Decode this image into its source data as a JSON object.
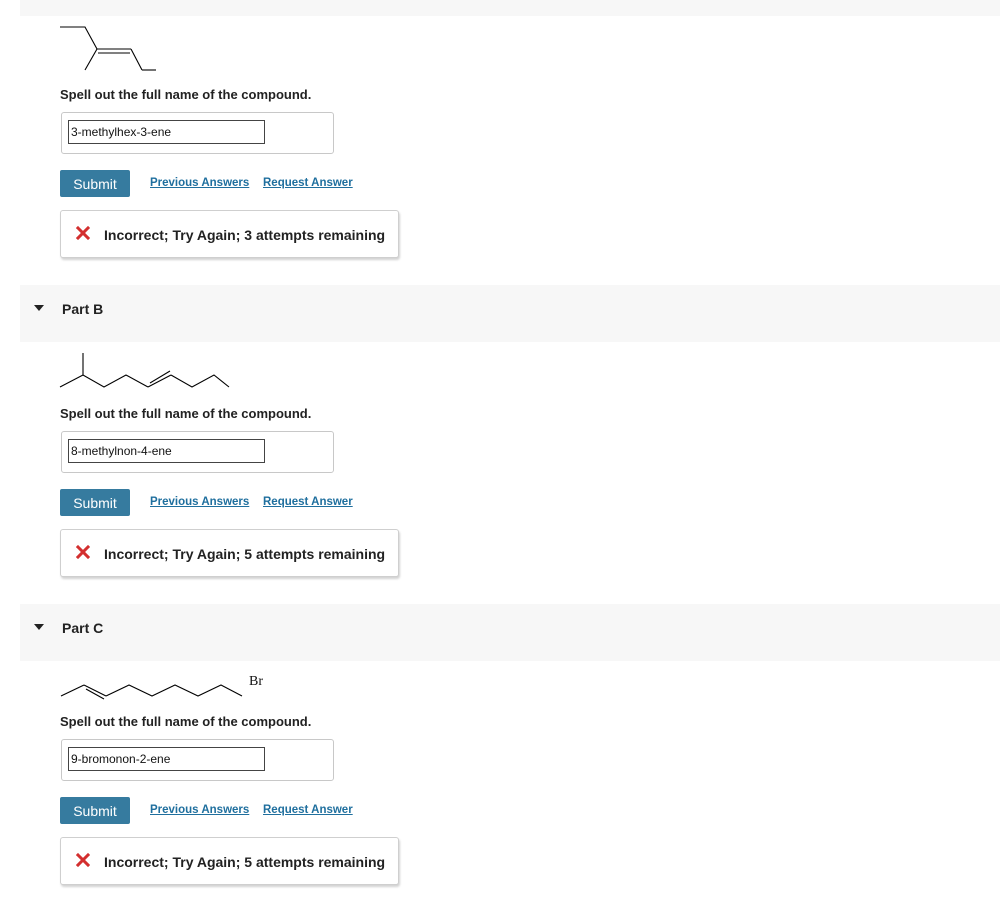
{
  "colors": {
    "submit_bg": "#367b9f",
    "link": "#1f6f9e",
    "incorrect_icon": "#d32f2f",
    "part_header_bg": "#f7f7f7"
  },
  "part_a": {
    "prompt": "Spell out the full name of the compound.",
    "answer_value": "3-methylhex-3-ene",
    "submit_label": "Submit",
    "previous_answers_label": "Previous Answers",
    "request_answer_label": "Request Answer",
    "feedback_icon": "incorrect-x-icon",
    "feedback_text": "Incorrect; Try Again; 3 attempts remaining"
  },
  "part_b": {
    "title": "Part B",
    "prompt": "Spell out the full name of the compound.",
    "answer_value": "8-methylnon-4-ene",
    "submit_label": "Submit",
    "previous_answers_label": "Previous Answers",
    "request_answer_label": "Request Answer",
    "feedback_icon": "incorrect-x-icon",
    "feedback_text": "Incorrect; Try Again; 5 attempts remaining"
  },
  "part_c": {
    "title": "Part C",
    "structure_label": "Br",
    "prompt": "Spell out the full name of the compound.",
    "answer_value": "9-bromonon-2-ene",
    "submit_label": "Submit",
    "previous_answers_label": "Previous Answers",
    "request_answer_label": "Request Answer",
    "feedback_icon": "incorrect-x-icon",
    "feedback_text": "Incorrect; Try Again; 5 attempts remaining"
  }
}
